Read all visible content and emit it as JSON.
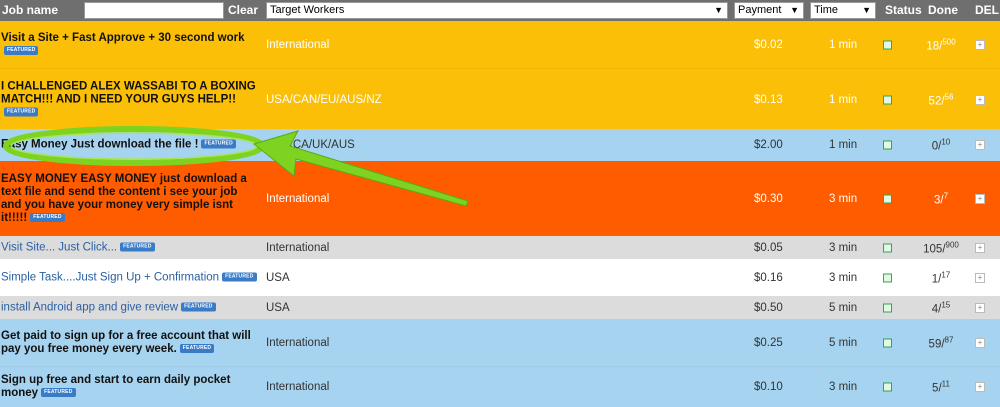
{
  "header": {
    "job_name_label": "Job name",
    "job_name_value": "",
    "clear_label": "Clear",
    "target_workers_value": "Target Workers",
    "payment_label": "Payment",
    "time_label": "Time",
    "status_label": "Status",
    "done_label": "Done",
    "del_label": "DEL"
  },
  "badge_text": "FEATURED",
  "rows": [
    {
      "name": "Visit a Site + Fast Approve + 30 second work",
      "target": "International",
      "payment": "$0.02",
      "time": "1 min",
      "done": "18",
      "total": "500"
    },
    {
      "name": "I CHALLENGED ALEX WASSABI TO A BOXING MATCH!!! AND I NEED YOUR GUYS HELP!!",
      "target": "USA/CAN/EU/AUS/NZ",
      "payment": "$0.13",
      "time": "1 min",
      "done": "52",
      "total": "56"
    },
    {
      "name": "Easy Money Just download the file !",
      "target": "USA/CA/UK/AUS",
      "payment": "$2.00",
      "time": "1 min",
      "done": "0",
      "total": "10"
    },
    {
      "name": "EASY MONEY EASY MONEY just download a text file and send the content i see your job and you have your money very simple isnt it!!!!!",
      "target": "International",
      "payment": "$0.30",
      "time": "3 min",
      "done": "3",
      "total": "7"
    },
    {
      "name": "Visit Site... Just Click...",
      "target": "International",
      "payment": "$0.05",
      "time": "3 min",
      "done": "105",
      "total": "900"
    },
    {
      "name": "Simple Task....Just Sign Up + Confirmation",
      "target": "USA",
      "payment": "$0.16",
      "time": "3 min",
      "done": "1",
      "total": "17"
    },
    {
      "name": "install Android app and give review",
      "target": "USA",
      "payment": "$0.50",
      "time": "5 min",
      "done": "4",
      "total": "15"
    },
    {
      "name": "Get paid to sign up for a free account that will pay you free money every week.",
      "target": "International",
      "payment": "$0.25",
      "time": "5 min",
      "done": "59",
      "total": "87"
    },
    {
      "name": "Sign up free and start to earn daily pocket money",
      "target": "International",
      "payment": "$0.10",
      "time": "3 min",
      "done": "5",
      "total": "11"
    }
  ],
  "colors": {
    "yellow": "#fbbf07",
    "blue": "#a6d3ef",
    "orange": "#ff5c00",
    "gray": "#dcdcdc",
    "white": "#ffffff",
    "header": "#6f6f6f",
    "highlight": "#7ed321"
  }
}
